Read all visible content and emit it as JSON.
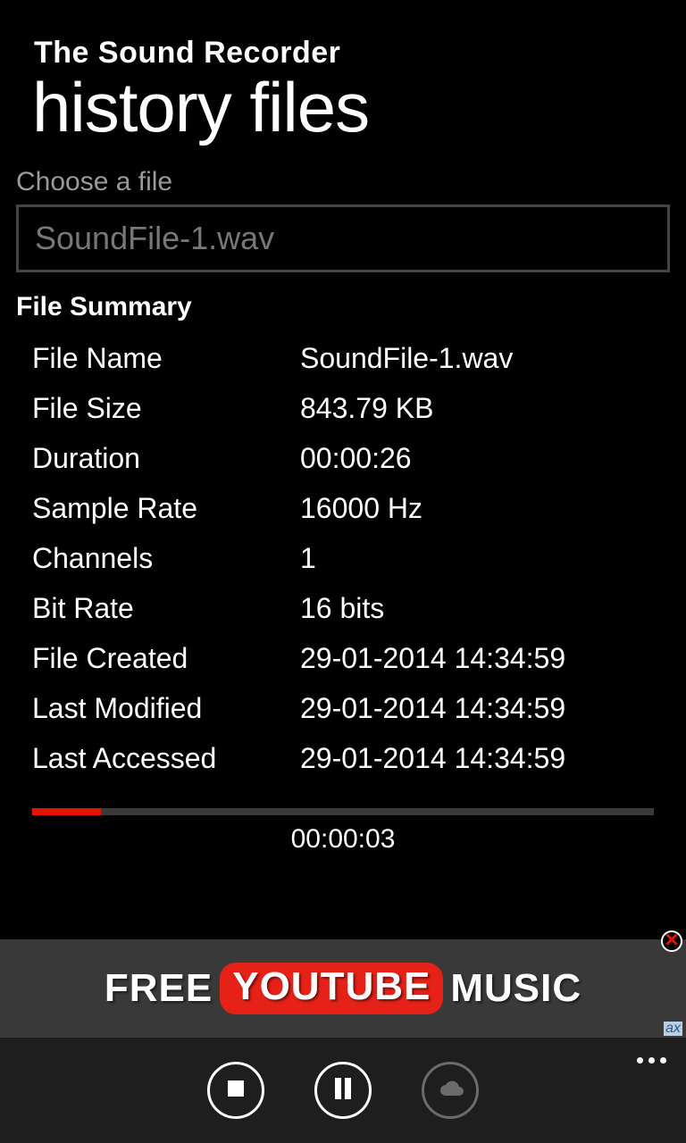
{
  "header": {
    "app_title": "The Sound Recorder",
    "page_title": "history files"
  },
  "chooser": {
    "label": "Choose a file",
    "selected": "SoundFile-1.wav"
  },
  "summary": {
    "header": "File Summary",
    "rows": [
      {
        "label": "File Name",
        "value": "SoundFile-1.wav"
      },
      {
        "label": "File Size",
        "value": "843.79 KB"
      },
      {
        "label": "Duration",
        "value": "00:00:26"
      },
      {
        "label": "Sample Rate",
        "value": "16000 Hz"
      },
      {
        "label": "Channels",
        "value": "1"
      },
      {
        "label": "Bit Rate",
        "value": "16 bits"
      },
      {
        "label": "File Created",
        "value": "29-01-2014 14:34:59"
      },
      {
        "label": "Last Modified",
        "value": "29-01-2014 14:34:59"
      },
      {
        "label": "Last Accessed",
        "value": "29-01-2014 14:34:59"
      }
    ]
  },
  "playback": {
    "elapsed": "00:00:03",
    "progress_pct": 11
  },
  "ad": {
    "word1": "FREE",
    "word2": "YOUTUBE",
    "word3": "MUSIC",
    "tag": "ax"
  },
  "appbar": {
    "buttons": {
      "stop": "stop",
      "pause": "pause",
      "cloud": "cloud-upload"
    }
  }
}
